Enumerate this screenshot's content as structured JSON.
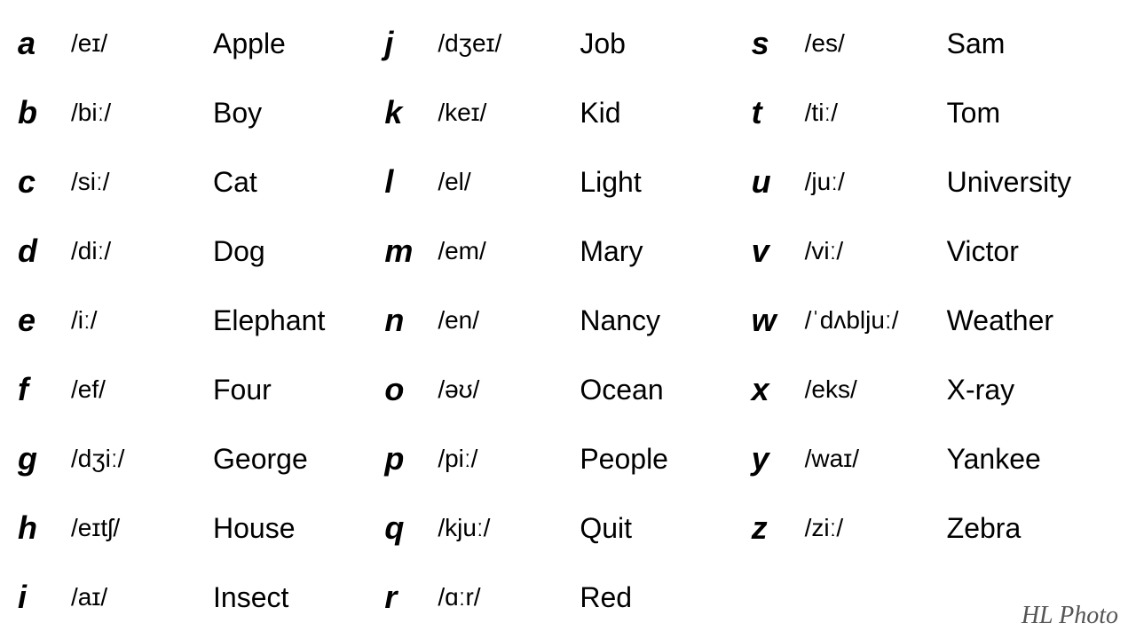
{
  "columns": [
    {
      "rows": [
        {
          "letter": "a",
          "phonetic": "/eɪ/",
          "word": "Apple"
        },
        {
          "letter": "b",
          "phonetic": "/biː/",
          "word": "Boy"
        },
        {
          "letter": "c",
          "phonetic": "/siː/",
          "word": "Cat"
        },
        {
          "letter": "d",
          "phonetic": "/diː/",
          "word": "Dog"
        },
        {
          "letter": "e",
          "phonetic": "/iː/",
          "word": "Elephant"
        },
        {
          "letter": "f",
          "phonetic": "/ef/",
          "word": "Four"
        },
        {
          "letter": "g",
          "phonetic": "/dʒiː/",
          "word": "George"
        },
        {
          "letter": "h",
          "phonetic": "/eɪtʃ/",
          "word": "House"
        },
        {
          "letter": "i",
          "phonetic": "/aɪ/",
          "word": "Insect"
        }
      ]
    },
    {
      "rows": [
        {
          "letter": "j",
          "phonetic": "/dʒeɪ/",
          "word": "Job"
        },
        {
          "letter": "k",
          "phonetic": "/keɪ/",
          "word": "Kid"
        },
        {
          "letter": "l",
          "phonetic": "/el/",
          "word": "Light"
        },
        {
          "letter": "m",
          "phonetic": "/em/",
          "word": "Mary"
        },
        {
          "letter": "n",
          "phonetic": "/en/",
          "word": "Nancy"
        },
        {
          "letter": "o",
          "phonetic": "/əʊ/",
          "word": "Ocean"
        },
        {
          "letter": "p",
          "phonetic": "/piː/",
          "word": "People"
        },
        {
          "letter": "q",
          "phonetic": "/kjuː/",
          "word": "Quit"
        },
        {
          "letter": "r",
          "phonetic": "/ɑːr/",
          "word": "Red"
        }
      ]
    },
    {
      "rows": [
        {
          "letter": "s",
          "phonetic": "/es/",
          "word": "Sam"
        },
        {
          "letter": "t",
          "phonetic": "/tiː/",
          "word": "Tom"
        },
        {
          "letter": "u",
          "phonetic": "/juː/",
          "word": "University"
        },
        {
          "letter": "v",
          "phonetic": "/viː/",
          "word": "Victor"
        },
        {
          "letter": "w",
          "phonetic": "/ˈdʌbljuː/",
          "word": "Weather"
        },
        {
          "letter": "x",
          "phonetic": "/eks/",
          "word": "X-ray"
        },
        {
          "letter": "y",
          "phonetic": "/waɪ/",
          "word": "Yankee"
        },
        {
          "letter": "z",
          "phonetic": "/ziː/",
          "word": "Zebra"
        },
        {
          "letter": "",
          "phonetic": "",
          "word": ""
        }
      ]
    }
  ],
  "watermark": "HL Photo"
}
